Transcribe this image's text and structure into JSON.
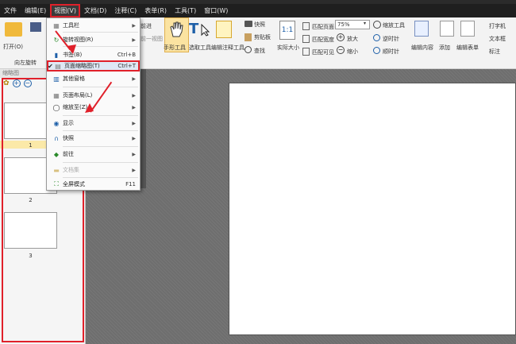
{
  "menubar": [
    "文件",
    "编辑(E)",
    "视图(V)",
    "文档(D)",
    "注释(C)",
    "表单(R)",
    "工具(T)",
    "窗口(W)"
  ],
  "ribbon": {
    "open": "打开(O)",
    "rotate": "向左旋转",
    "forward": "前进",
    "prev_view": "前一视图",
    "hand_tool": "手形工具",
    "select_tool": "选取工具",
    "annot_tool": "编辑注释工具",
    "snapshot": "快照",
    "clipboard": "剪贴板",
    "find": "查找",
    "actual_size": "实际大小",
    "fit_page": "匹配页面",
    "zoom_value": "75%",
    "fit_width": "匹配宽度",
    "fit_visible": "匹配可见",
    "zoom_tool": "缩放工具",
    "zoom_in": "放大",
    "zoom_out": "缩小",
    "ccw": "逆时针",
    "cw": "顺时针",
    "edit_content": "编辑内容",
    "add": "添加",
    "edit_form": "编辑表单",
    "typewriter": "打字机",
    "textbox": "文本框",
    "mark": "标注"
  },
  "sidebar": {
    "header": "缩略图",
    "pages": [
      "1",
      "2",
      "3"
    ]
  },
  "dropdown": {
    "items": [
      {
        "label": "工具栏",
        "shortcut": "",
        "submenu": true
      },
      {
        "label": "旋转视图(R)",
        "shortcut": "",
        "submenu": true
      },
      {
        "label": "书签(B)",
        "shortcut": "Ctrl+B",
        "submenu": false
      },
      {
        "label": "页面缩略图(T)",
        "shortcut": "Ctrl+T",
        "submenu": false
      },
      {
        "label": "其他窗格",
        "shortcut": "",
        "submenu": true
      },
      {
        "label": "页面布局(L)",
        "shortcut": "",
        "submenu": true
      },
      {
        "label": "缩放至(Z)",
        "shortcut": "",
        "submenu": true
      },
      {
        "label": "显示",
        "shortcut": "",
        "submenu": true
      },
      {
        "label": "快照",
        "shortcut": "",
        "submenu": true
      },
      {
        "label": "前往",
        "shortcut": "",
        "submenu": true
      },
      {
        "label": "文档集",
        "shortcut": "",
        "submenu": true
      },
      {
        "label": "全屏模式",
        "shortcut": "F11",
        "submenu": false
      }
    ],
    "selected_index": 3
  },
  "colors": {
    "highlight": "#e0202a",
    "menubar": "#1f1f1f"
  }
}
